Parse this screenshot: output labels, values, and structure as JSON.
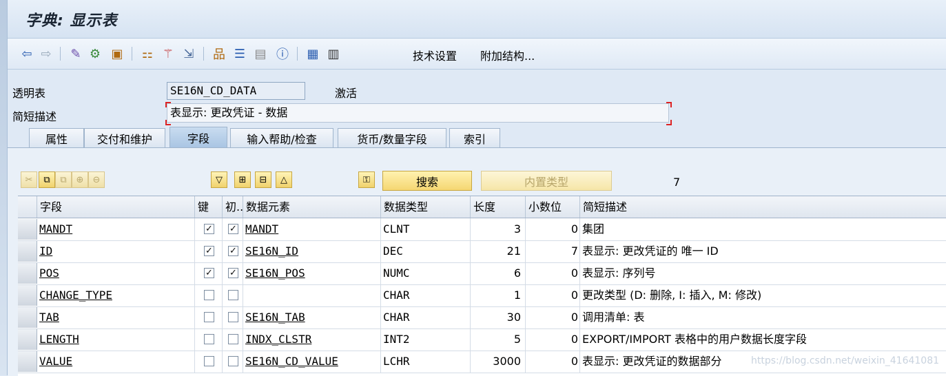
{
  "window": {
    "title": "字典: 显示表"
  },
  "toolbar": {
    "tech_settings": "技术设置",
    "append_struct": "附加结构..."
  },
  "header": {
    "table_label": "透明表",
    "table_name": "SE16N_CD_DATA",
    "status": "激活",
    "desc_label": "简短描述",
    "desc_value": "表显示: 更改凭证 - 数据"
  },
  "tabs": [
    {
      "label": "属性"
    },
    {
      "label": "交付和维护"
    },
    {
      "label": "字段"
    },
    {
      "label": "输入帮助/检查"
    },
    {
      "label": "货币/数量字段"
    },
    {
      "label": "索引"
    }
  ],
  "active_tab": "字段",
  "table_toolbar": {
    "search_label": "搜索",
    "builtin_type_label": "内置类型",
    "count": "7"
  },
  "columns": [
    "字段",
    "键",
    "初...",
    "数据元素",
    "数据类型",
    "长度",
    "小数位",
    "简短描述"
  ],
  "rows": [
    {
      "field": "MANDT",
      "key": true,
      "init": true,
      "element": "MANDT",
      "type": "CLNT",
      "length": "3",
      "decimals": "0",
      "desc": "集团"
    },
    {
      "field": "ID",
      "key": true,
      "init": true,
      "element": "SE16N_ID",
      "type": "DEC",
      "length": "21",
      "decimals": "7",
      "desc": "表显示: 更改凭证的 唯一 ID"
    },
    {
      "field": "POS",
      "key": true,
      "init": true,
      "element": "SE16N_POS",
      "type": "NUMC",
      "length": "6",
      "decimals": "0",
      "desc": "表显示: 序列号"
    },
    {
      "field": "CHANGE_TYPE",
      "key": false,
      "init": false,
      "element": "",
      "type": "CHAR",
      "length": "1",
      "decimals": "0",
      "desc": "更改类型 (D: 删除, I: 插入, M: 修改)"
    },
    {
      "field": "TAB",
      "key": false,
      "init": false,
      "element": "SE16N_TAB",
      "type": "CHAR",
      "length": "30",
      "decimals": "0",
      "desc": "调用清单: 表"
    },
    {
      "field": "LENGTH",
      "key": false,
      "init": false,
      "element": "INDX_CLSTR",
      "type": "INT2",
      "length": "5",
      "decimals": "0",
      "desc": "EXPORT/IMPORT 表格中的用户数据长度字段"
    },
    {
      "field": "VALUE",
      "key": false,
      "init": false,
      "element": "SE16N_CD_VALUE",
      "type": "LCHR",
      "length": "3000",
      "decimals": "0",
      "desc": "表显示: 更改凭证的数据部分"
    }
  ],
  "watermark": "https://blog.csdn.net/weixin_41641081",
  "colors": {
    "accent": "#a9c5e3",
    "button_yellow": "#f5d772",
    "background": "#dfe9f5"
  }
}
